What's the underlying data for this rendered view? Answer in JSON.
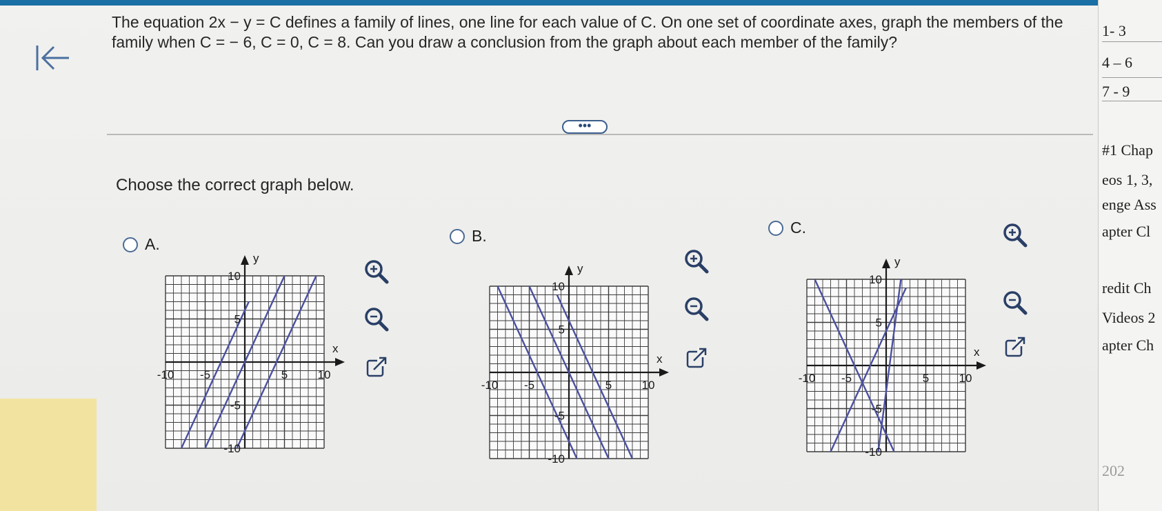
{
  "question": {
    "text": "The equation 2x − y = C defines a family of lines, one line for each value of C. On one set of coordinate axes, graph the members of the family when C = − 6, C = 0, C = 8. Can you draw a conclusion from the graph about each member of the family?",
    "instruction": "Choose the correct graph below.",
    "expand_label": "•••"
  },
  "options": [
    {
      "letter": "A.",
      "x_label": "x",
      "y_label": "y",
      "x_ticks": [
        "-10",
        "-5",
        "5",
        "10"
      ],
      "y_ticks": [
        "10",
        "5",
        "-5",
        "-10"
      ]
    },
    {
      "letter": "B.",
      "x_label": "x",
      "y_label": "y",
      "x_ticks": [
        "-10",
        "-5",
        "5",
        "10"
      ],
      "y_ticks": [
        "10",
        "5",
        "-5",
        "-10"
      ]
    },
    {
      "letter": "C.",
      "x_label": "x",
      "y_label": "y",
      "x_ticks": [
        "-10",
        "-5",
        "5",
        "10"
      ],
      "y_ticks": [
        "10",
        "5",
        "-5",
        "-10"
      ]
    }
  ],
  "chart_data": [
    {
      "type": "line",
      "xlim": [
        -10,
        10
      ],
      "ylim": [
        -10,
        10
      ],
      "grid": true,
      "series": [
        {
          "x": [
            -10,
            0.5
          ],
          "y": [
            -14,
            7
          ]
        },
        {
          "x": [
            -6,
            6
          ],
          "y": [
            -12,
            12
          ]
        },
        {
          "x": [
            -2,
            9
          ],
          "y": [
            -12,
            10
          ]
        }
      ]
    },
    {
      "type": "line",
      "xlim": [
        -10,
        10
      ],
      "ylim": [
        -10,
        10
      ],
      "grid": true,
      "series": [
        {
          "x": [
            -10,
            2
          ],
          "y": [
            12,
            -12
          ]
        },
        {
          "x": [
            -6,
            6
          ],
          "y": [
            12,
            -12
          ]
        },
        {
          "x": [
            -1.5,
            8.5
          ],
          "y": [
            9,
            -11
          ]
        }
      ]
    },
    {
      "type": "line",
      "xlim": [
        -10,
        10
      ],
      "ylim": [
        -10,
        10
      ],
      "grid": true,
      "series": [
        {
          "x": [
            -9,
            1
          ],
          "y": [
            10,
            -10
          ]
        },
        {
          "x": [
            -7,
            2.5
          ],
          "y": [
            -10,
            9
          ]
        },
        {
          "x": [
            -1,
            2
          ],
          "y": [
            -10,
            11
          ]
        }
      ]
    }
  ],
  "right_panel": {
    "items": [
      "1- 3",
      "4 – 6",
      "7 - 9",
      "#1 Chap",
      "eos 1, 3,",
      "enge Ass",
      "apter Cl",
      "redit Ch",
      "Videos 2",
      "apter Ch",
      "202"
    ]
  },
  "colors": {
    "line": "#4a4fa0",
    "axis": "#1a1a1a",
    "grid": "#3a3a3a",
    "accent": "#1a6fa5"
  }
}
